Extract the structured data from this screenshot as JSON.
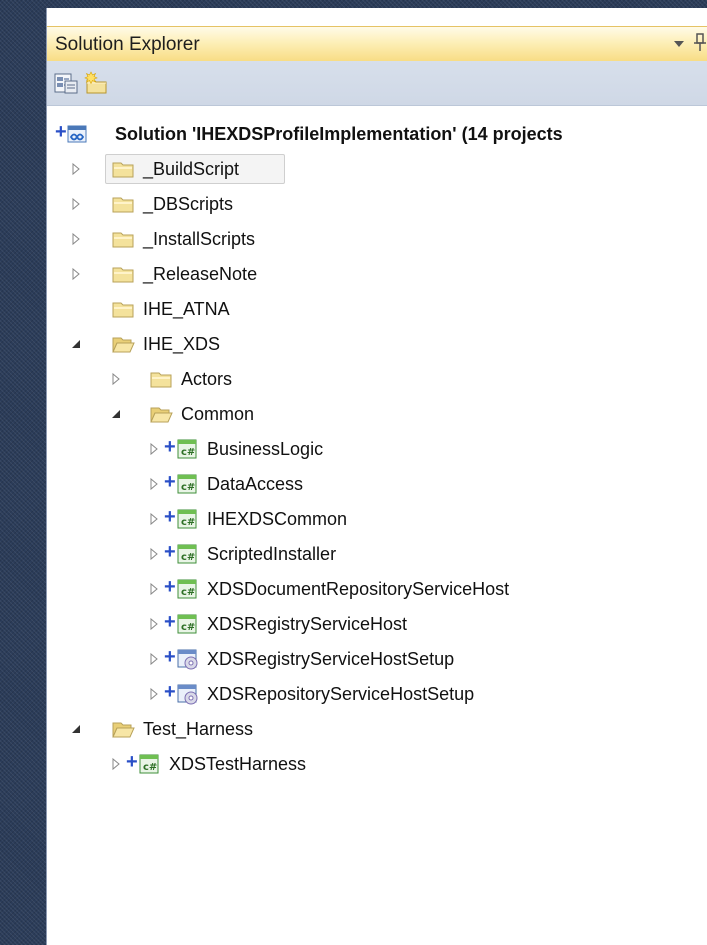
{
  "panel": {
    "title": "Solution Explorer"
  },
  "toolbar": {
    "buttons": [
      {
        "icon": "properties-icon"
      },
      {
        "icon": "show-all-files-icon"
      }
    ]
  },
  "tree": {
    "solution": "Solution 'IHEXDSProfileImplementation' (14 projects",
    "items": [
      {
        "label": "_BuildScript"
      },
      {
        "label": "_DBScripts"
      },
      {
        "label": "_InstallScripts"
      },
      {
        "label": "_ReleaseNote"
      },
      {
        "label": "IHE_ATNA"
      },
      {
        "label": "IHE_XDS"
      },
      {
        "label": "Actors"
      },
      {
        "label": "Common"
      },
      {
        "label": "BusinessLogic"
      },
      {
        "label": "DataAccess"
      },
      {
        "label": "IHEXDSCommon"
      },
      {
        "label": "ScriptedInstaller"
      },
      {
        "label": "XDSDocumentRepositoryServiceHost"
      },
      {
        "label": "XDSRegistryServiceHost"
      },
      {
        "label": "XDSRegistryServiceHostSetup"
      },
      {
        "label": "XDSRepositoryServiceHostSetup"
      },
      {
        "label": "Test_Harness"
      },
      {
        "label": "XDSTestHarness"
      }
    ]
  }
}
